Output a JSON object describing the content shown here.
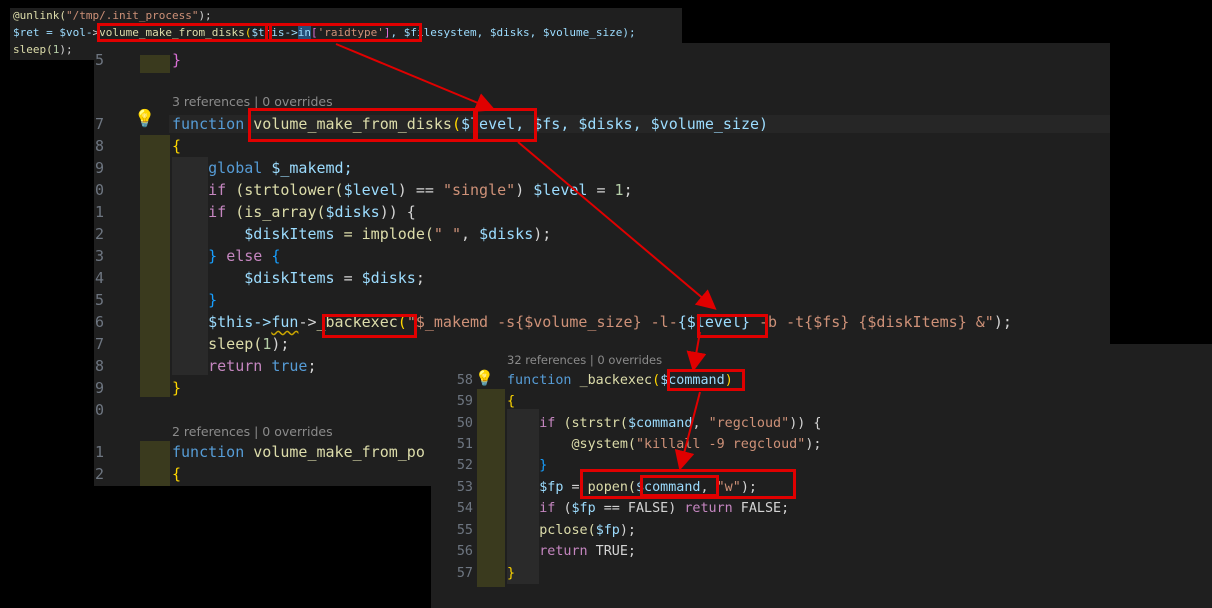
{
  "snippet": {
    "line1": [
      "@unlink(",
      "\"/tmp/.init_process\"",
      ");"
    ],
    "line2": {
      "prefix": "$ret = $vol-",
      "arrow": ">",
      "fn": "volume_make_from_disks",
      "paren": "(",
      "this": "$this->",
      "in": "in",
      "key_open": "[",
      "key": "'raidtype'",
      "key_close": "]",
      "rest": ", $filesystem, $disks, $volume_size);"
    },
    "line3": [
      "sleep(",
      "1",
      ");"
    ]
  },
  "editor_main": {
    "line_numbers": [
      "5",
      "6",
      "7",
      "8",
      "9",
      "0",
      "1",
      "2",
      "3",
      "4",
      "5",
      "6",
      "7",
      "8",
      "9",
      "0",
      "1",
      "2"
    ],
    "codelens_1": "3 references | 0 overrides",
    "codelens_2": "2 references | 0 overrides",
    "lines": {
      "close_brace_top": "}",
      "fn_kw": "function",
      "fn_name": "volume_make_from_disks",
      "fn_open": "(",
      "p_level": "$level",
      "p_rest": ", $fs, $disks, $volume_size)",
      "brace_open": "{",
      "global_kw": "global",
      "global_var": "$_makemd;",
      "if1_kw": "if",
      "if1_a": "(strtolower(",
      "if1_var": "$level",
      "if1_b": ") == ",
      "if1_str": "\"single\"",
      "if1_c": ") ",
      "if1_var2": "$level",
      "if1_d": " = ",
      "if1_num": "1",
      "if1_e": ";",
      "if2_kw": "if",
      "if2_a": "(is_array(",
      "if2_var": "$disks",
      "if2_b": ")) {",
      "di1_var": "$diskItems",
      "di1_a": " = implode(",
      "di1_str": "\" \"",
      "di1_b": ", ",
      "di1_var2": "$disks",
      "di1_c": ");",
      "else_a": "} ",
      "else_kw": "else",
      "else_b": " {",
      "di2_var": "$diskItems",
      "di2_a": " = ",
      "di2_var2": "$disks",
      "di2_b": ";",
      "close_if": "}",
      "bx_this": "$this->",
      "bx_fun": "fun",
      "bx_arrow": "->",
      "bx_name": "_backexec",
      "bx_open": "(",
      "bx_str1": "\"$_makemd -s{$volume_size} -l-",
      "bx_level": "{$level}",
      "bx_str2": " -b -t{$fs} {$diskItems} &\"",
      "bx_close": ");",
      "sleep_a": "sleep(",
      "sleep_num": "1",
      "sleep_b": ");",
      "ret_kw": "return",
      "ret_val": "true",
      "ret_end": ";",
      "brace_close": "}",
      "fn2_kw": "function",
      "fn2_name": "volume_make_from_po",
      "brace_open2": "{"
    }
  },
  "editor_exec": {
    "line_numbers": [
      "58",
      "59",
      "50",
      "51",
      "52",
      "53",
      "54",
      "55",
      "56",
      "57"
    ],
    "codelens": "32 references | 0 overrides",
    "lines": {
      "fn_kw": "function",
      "fn_name": "_backexec",
      "fn_open": "(",
      "param": "$command",
      "fn_close": ")",
      "brace_open": "{",
      "if_kw": "if",
      "if_a": "(strstr(",
      "if_var": "$command",
      "if_b": ", ",
      "if_str": "\"regcloud\"",
      "if_c": ")) {",
      "sys_a": "@system(",
      "sys_str": "\"killall -9 regcloud\"",
      "sys_b": ");",
      "close_if": "}",
      "fp_var": "$fp",
      "fp_a": " = ",
      "fp_fn": "popen(",
      "fp_cmd": "$command",
      "fp_b": ", ",
      "fp_str": "\"w\"",
      "fp_c": ");",
      "if2_kw": "if",
      "if2_a": "(",
      "if2_var": "$fp",
      "if2_b": " == FALSE) ",
      "if2_ret": "return",
      "if2_c": " FALSE;",
      "pclose_a": "pclose(",
      "pclose_var": "$fp",
      "pclose_b": ");",
      "ret_kw": "return",
      "ret_c": " TRUE;",
      "brace_close": "}"
    }
  },
  "colors": {
    "highlight_box": "#e00000",
    "arrow": "#e00000",
    "editor_bg": "#1f1f1f",
    "page_bg": "#000000"
  }
}
